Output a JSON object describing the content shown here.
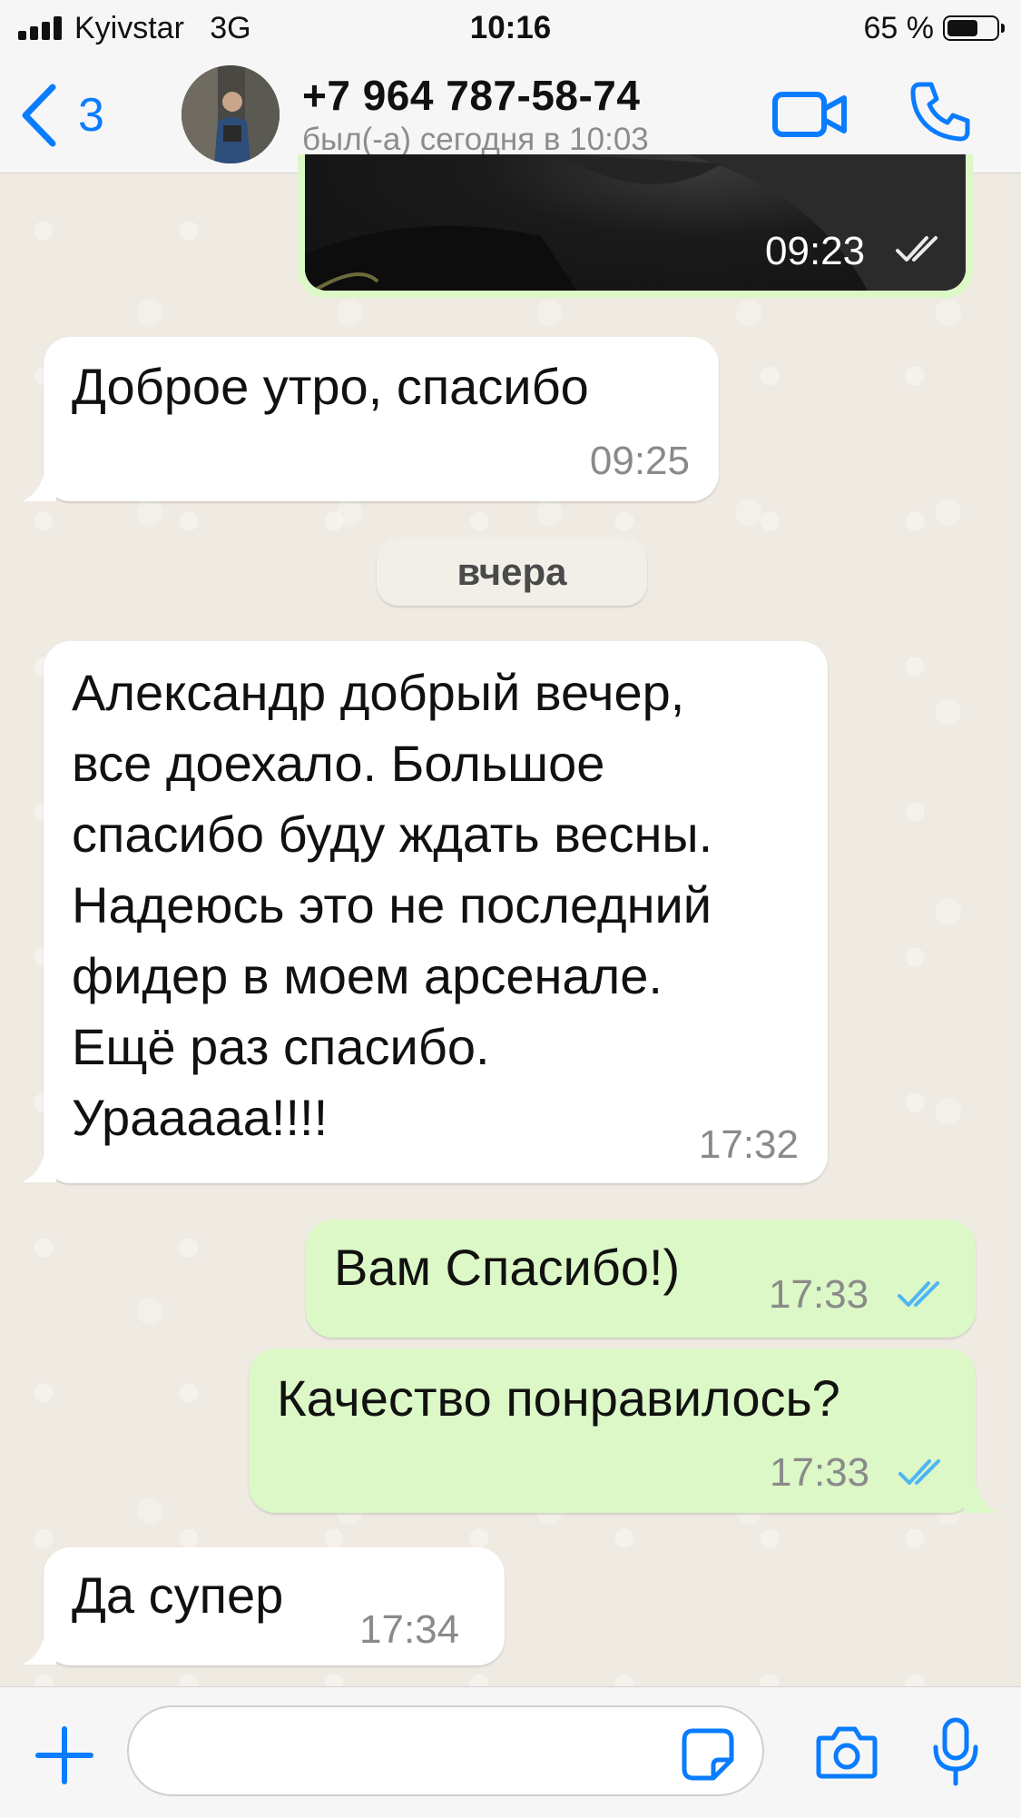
{
  "status_bar": {
    "carrier": "Kyivstar   3G",
    "time": "10:16",
    "battery_percent": "65 %",
    "battery_level": 0.65
  },
  "header": {
    "back_count": "3",
    "contact_name": "+7 964 787-58-74",
    "contact_status": "был(-а) сегодня в 10:03",
    "icons": [
      "chevron-left-icon",
      "video-camera-icon",
      "phone-icon"
    ]
  },
  "messages": [
    {
      "direction": "out",
      "type": "image",
      "time": "09:23",
      "read": true
    },
    {
      "direction": "in",
      "text": "Доброе утро, спасибо",
      "time": "09:25"
    },
    {
      "direction": "in",
      "text": "Александр добрый вечер,\nвсе доехало. Большое\nспасибо буду ждать весны.\nНадеюсь это не последний\nфидер в моем арсенале.\nЕщё раз спасибо.\nУраааaa!!!!",
      "time": "17:32"
    },
    {
      "direction": "out",
      "text": "Вам Спасибо!)",
      "time": "17:33",
      "read": true
    },
    {
      "direction": "out",
      "text": "Качество понравилось?",
      "time": "17:33",
      "read": true
    },
    {
      "direction": "in",
      "text": "Да супер",
      "time": "17:34"
    }
  ],
  "date_divider": "вчера",
  "composer": {
    "placeholder": "",
    "icons": [
      "plus-icon",
      "sticker-icon",
      "camera-icon",
      "microphone-icon"
    ]
  },
  "colors": {
    "accent": "#0a7cff",
    "outgoing_bubble": "#dbf8c6",
    "incoming_bubble": "#ffffff",
    "read_ticks": "#4fb5f5",
    "wallpaper": "#efeae2"
  }
}
